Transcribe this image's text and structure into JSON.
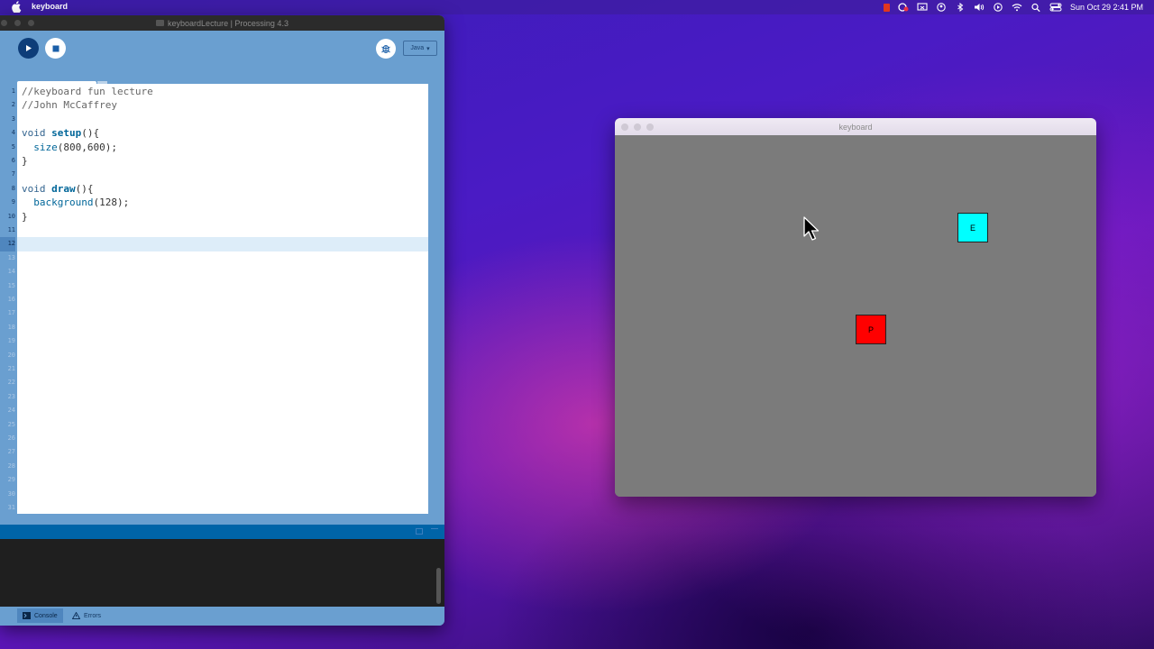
{
  "menubar": {
    "app_name": "keyboard",
    "clock": "Sun Oct 29  2:41 PM"
  },
  "processing": {
    "window_title": "keyboardLecture | Processing 4.3",
    "mode": "Java",
    "tab_name": "keyboardLecture",
    "current_line": 12,
    "line_count": 31,
    "code_lines": [
      "//keyboard fun lecture",
      "//John McCaffrey",
      "",
      "void setup(){",
      "  size(800,600);",
      "}",
      "",
      "void draw(){",
      "  background(128);",
      "}",
      "",
      ""
    ],
    "bottom_tabs": [
      "Console",
      "Errors"
    ]
  },
  "sketch": {
    "window_title": "keyboard",
    "boxes": [
      {
        "label": "E",
        "color": "#00ffff"
      },
      {
        "label": "P",
        "color": "#ff0000"
      }
    ]
  }
}
